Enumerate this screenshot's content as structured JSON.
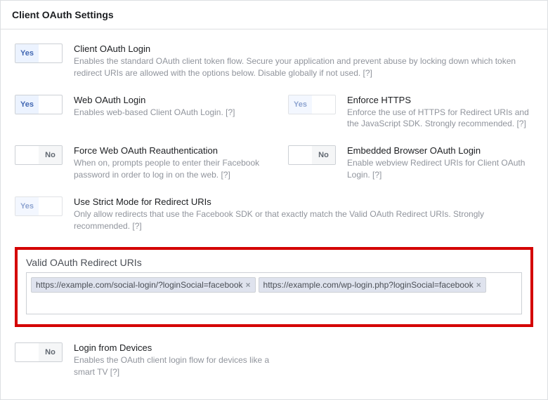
{
  "header": {
    "title": "Client OAuth Settings"
  },
  "toggle_labels": {
    "yes": "Yes",
    "no": "No"
  },
  "rows": [
    [
      {
        "title": "Client OAuth Login",
        "desc": "Enables the standard OAuth client token flow. Secure your application and prevent abuse by locking down which token redirect URIs are allowed with the options below. Disable globally if not used.  [?]",
        "state": "yes",
        "disabled": false
      }
    ],
    [
      {
        "title": "Web OAuth Login",
        "desc": "Enables web-based Client OAuth Login.  [?]",
        "state": "yes",
        "disabled": false
      },
      {
        "title": "Enforce HTTPS",
        "desc": "Enforce the use of HTTPS for Redirect URIs and the JavaScript SDK. Strongly recommended.  [?]",
        "state": "yes",
        "disabled": true
      }
    ],
    [
      {
        "title": "Force Web OAuth Reauthentication",
        "desc": "When on, prompts people to enter their Facebook password in order to log in on the web.  [?]",
        "state": "no",
        "disabled": false
      },
      {
        "title": "Embedded Browser OAuth Login",
        "desc": "Enable webview Redirect URIs for Client OAuth Login.  [?]",
        "state": "no",
        "disabled": false
      }
    ],
    [
      {
        "title": "Use Strict Mode for Redirect URIs",
        "desc": "Only allow redirects that use the Facebook SDK or that exactly match the Valid OAuth Redirect URIs. Strongly recommended.  [?]",
        "state": "yes",
        "disabled": true
      }
    ]
  ],
  "redirect_section": {
    "label": "Valid OAuth Redirect URIs",
    "chips": [
      "https://example.com/social-login/?loginSocial=facebook",
      "https://example.com/wp-login.php?loginSocial=facebook"
    ]
  },
  "login_from_devices": {
    "title": "Login from Devices",
    "desc": "Enables the OAuth client login flow for devices like a smart TV  [?]",
    "state": "no",
    "disabled": false
  }
}
